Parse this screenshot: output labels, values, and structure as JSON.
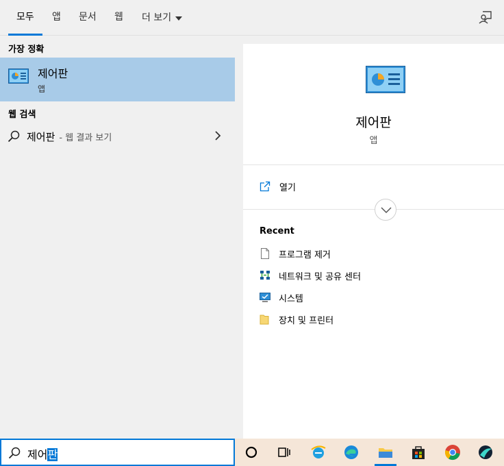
{
  "tabs": [
    {
      "label": "모두",
      "active": true
    },
    {
      "label": "앱"
    },
    {
      "label": "문서"
    },
    {
      "label": "웹"
    },
    {
      "label": "더 보기"
    }
  ],
  "icons": {
    "feedback": "feedback-icon",
    "best_match": "control-panel-icon",
    "search": "search-icon",
    "open": "open-icon",
    "expand": "chevron-down-icon"
  },
  "left": {
    "best_match_heading": "가장 정확",
    "best_match": {
      "title": "제어판",
      "subtitle": "앱"
    },
    "web_heading": "웹 검색",
    "web_result": {
      "query": "제어판",
      "hint": "- 웹 결과 보기"
    }
  },
  "right": {
    "title": "제어판",
    "subtitle": "앱",
    "open_label": "열기",
    "recent_heading": "Recent",
    "recent": [
      {
        "label": "프로그램 제거",
        "icon": "document-icon"
      },
      {
        "label": "네트워크 및 공유 센터",
        "icon": "network-icon"
      },
      {
        "label": "시스템",
        "icon": "monitor-icon"
      },
      {
        "label": "장치 및 프린터",
        "icon": "folder-icon"
      }
    ]
  },
  "search": {
    "typed": "제어",
    "selected": "판"
  },
  "taskbar": [
    "cortana-icon",
    "task-view-icon",
    "internet-explorer-icon",
    "edge-icon",
    "file-explorer-icon",
    "store-icon",
    "chrome-icon",
    "app-icon"
  ],
  "colors": {
    "accent": "#0078d7",
    "selection": "#a8cbe8",
    "taskbar": "#f5e6d8"
  }
}
